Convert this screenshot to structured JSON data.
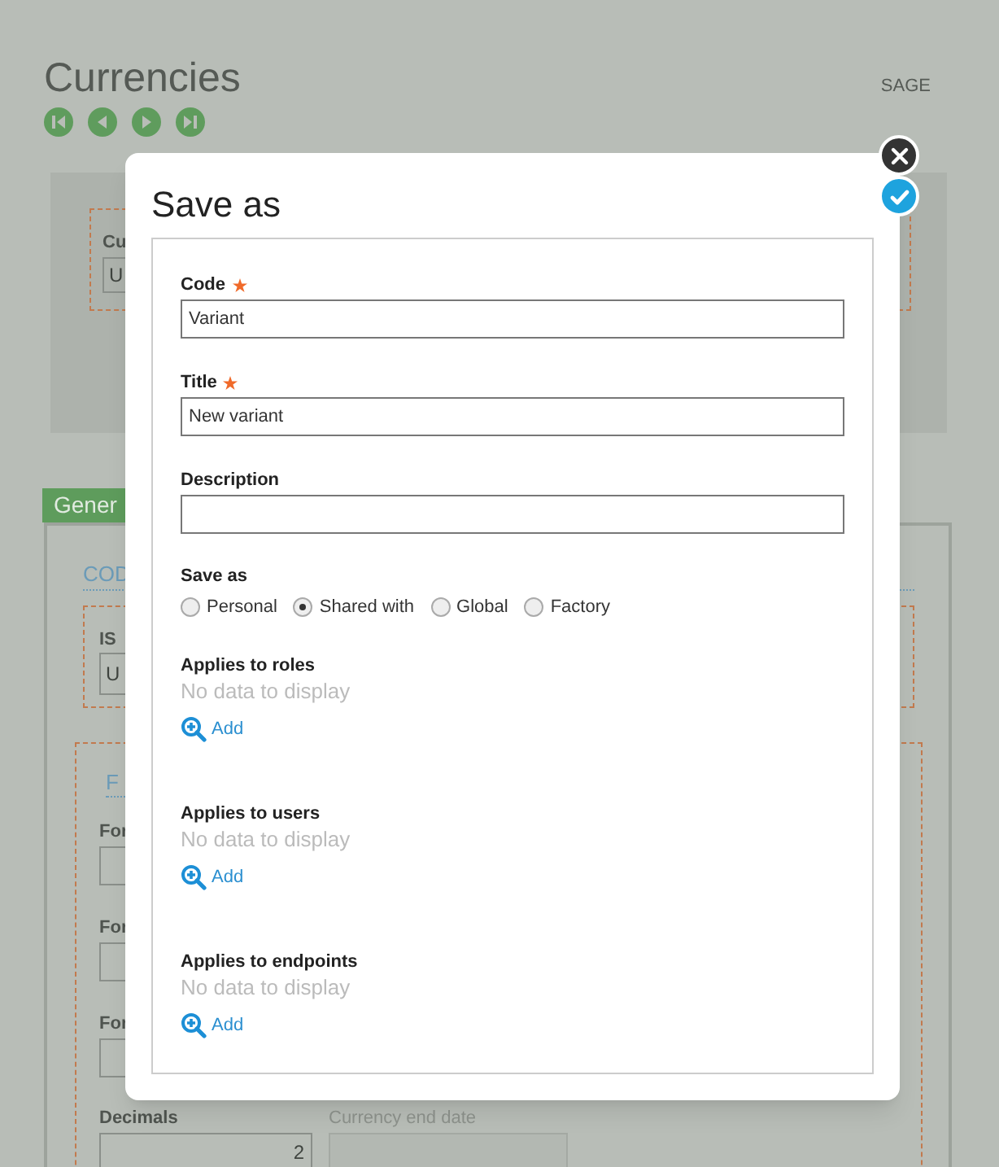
{
  "page": {
    "title": "Currencies",
    "brand": "SAGE",
    "nav_buttons": [
      {
        "kind": "first"
      },
      {
        "kind": "previous"
      },
      {
        "kind": "next"
      },
      {
        "kind": "last"
      }
    ],
    "header_field": {
      "label": "Cu",
      "value": "U"
    },
    "tabs": [
      {
        "label": "Gener",
        "selected": true
      }
    ],
    "section_link": "COD",
    "iso_field": {
      "label": "IS",
      "value": "U"
    },
    "format_section": {
      "title": "F",
      "fields": [
        {
          "label": "For"
        },
        {
          "label": "For"
        },
        {
          "label": "For"
        }
      ],
      "decimals": {
        "label": "Decimals",
        "value": "2"
      }
    },
    "end_date": {
      "label": "Currency end date"
    }
  },
  "dialog": {
    "title": "Save as",
    "fields": [
      {
        "label": "Code",
        "required": true,
        "value": "Variant"
      },
      {
        "label": "Title",
        "required": true,
        "value": "New variant"
      },
      {
        "label": "Description",
        "required": false
      }
    ],
    "save_as": {
      "label": "Save as",
      "options": [
        {
          "label": "Personal",
          "selected": false
        },
        {
          "label": "Shared with",
          "selected": true
        },
        {
          "label": "Global",
          "selected": false
        },
        {
          "label": "Factory",
          "selected": false
        }
      ]
    },
    "lists": [
      {
        "label": "Applies to roles",
        "empty_text": "No data to display",
        "add_label": "Add"
      },
      {
        "label": "Applies to users",
        "empty_text": "No data to display",
        "add_label": "Add"
      },
      {
        "label": "Applies to endpoints",
        "empty_text": "No data to display",
        "add_label": "Add"
      }
    ],
    "buttons": [
      {
        "kind": "close"
      },
      {
        "kind": "confirm"
      }
    ]
  }
}
